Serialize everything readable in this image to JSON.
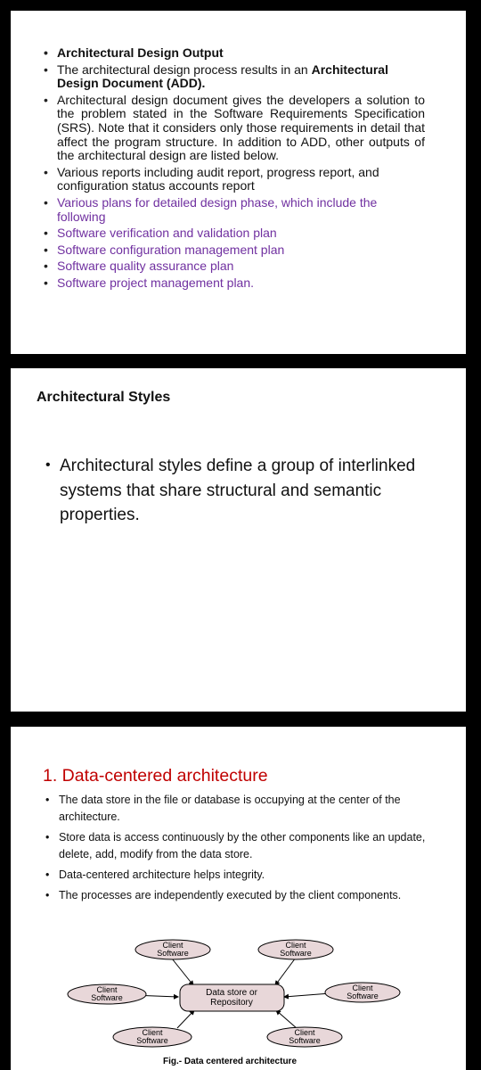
{
  "slide1": {
    "items": [
      {
        "text": "Architectural Design Output"
      },
      {
        "prefix": "The architectural design process results in an ",
        "bold": "Architectural Design Document (ADD)."
      },
      {
        "text": "Architectural design document gives the developers a solution to the problem stated in the Software Requirements Specification (SRS). Note that it considers only those requirements in detail that affect the program structure. In addition to ADD, other outputs of the architectural design are listed below."
      },
      {
        "text": "Various reports including audit report, progress report, and configuration status accounts report"
      },
      {
        "text": "Various plans for detailed design phase, which include the following"
      },
      {
        "text": "Software verification and validation plan"
      },
      {
        "text": "Software configuration management plan"
      },
      {
        "text": "Software quality assurance plan"
      },
      {
        "text": "Software project management plan."
      }
    ]
  },
  "slide2": {
    "title": "Architectural Styles",
    "bullet": "Architectural styles define a group of interlinked systems that share structural and semantic properties."
  },
  "slide3": {
    "title": "1. Data-centered architecture",
    "bullets": [
      "The data store in the file or database is occupying at the center of the architecture.",
      "Store data is access continuously by the other components like an update, delete, add, modify from the data store.",
      "Data-centered architecture helps integrity.",
      "The processes are independently executed by the client components."
    ],
    "diagram": {
      "center_line1": "Data store or",
      "center_line2": "Repository",
      "client_line1": "Client",
      "client_line2": "Software",
      "caption": "Fig.- Data centered architecture",
      "fill_color": "#e8d7d9"
    }
  }
}
